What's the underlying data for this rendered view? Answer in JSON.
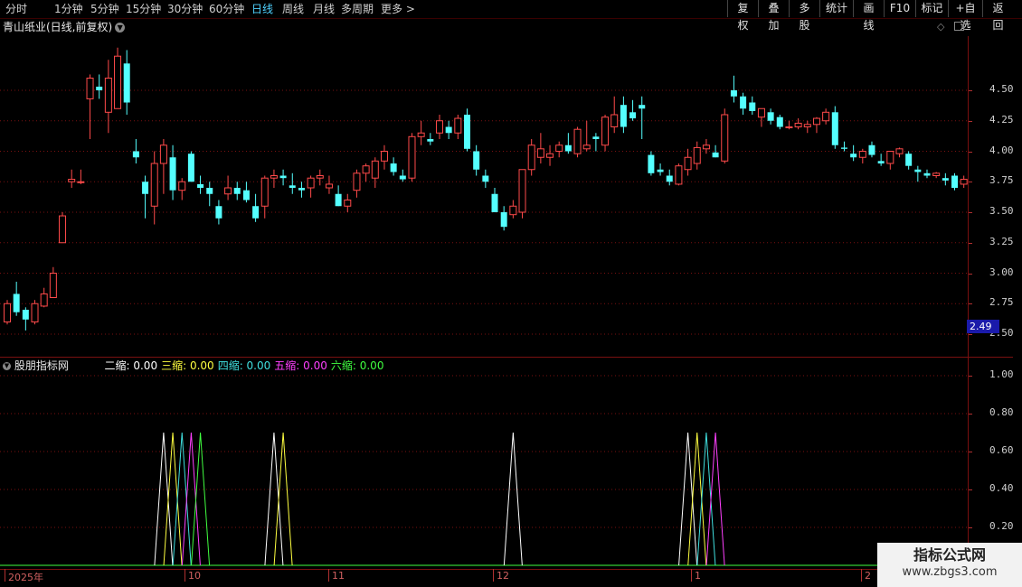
{
  "toolbar": {
    "periods": [
      "分时",
      "1分钟",
      "5分钟",
      "15分钟",
      "30分钟",
      "60分钟",
      "日线",
      "周线",
      "月线",
      "多周期",
      "更多 >"
    ],
    "active_period": "日线",
    "right_buttons": [
      "复权",
      "叠加",
      "多股",
      "统计",
      "画线",
      "F10",
      "标记",
      "+自选",
      "返回"
    ]
  },
  "stock": {
    "title": "青山纸业(日线,前复权)"
  },
  "price_axis": {
    "ticks": [
      "4.50",
      "4.25",
      "4.00",
      "3.75",
      "3.50",
      "3.25",
      "3.00",
      "2.75",
      "2.50"
    ],
    "current_price": "2.49"
  },
  "indicator": {
    "name": "股朋指标网",
    "legend": [
      {
        "label": "二缩:",
        "value": "0.00",
        "color": "#ffffff"
      },
      {
        "label": "三缩:",
        "value": "0.00",
        "color": "#ffff40"
      },
      {
        "label": "四缩:",
        "value": "0.00",
        "color": "#40e0e0"
      },
      {
        "label": "五缩:",
        "value": "0.00",
        "color": "#ff40ff"
      },
      {
        "label": "六缩:",
        "value": "0.00",
        "color": "#40ff40"
      }
    ],
    "axis_ticks": [
      "1.00",
      "0.80",
      "0.60",
      "0.40",
      "0.20"
    ]
  },
  "date_axis": {
    "labels": [
      "2025年",
      "10",
      "11",
      "12",
      "1",
      "2"
    ]
  },
  "watermark": {
    "title": "指标公式网",
    "url": "www.zbgs3.com"
  },
  "colors": {
    "up": "#ff4a4a",
    "down": "#54ffff",
    "grid": "#7a1010"
  },
  "chart_data": [
    {
      "type": "candlestick",
      "title": "青山纸业(日线,前复权)",
      "ylim": [
        2.45,
        4.85
      ],
      "y_ticks": [
        2.5,
        2.75,
        3.0,
        3.25,
        3.5,
        3.75,
        4.0,
        4.25,
        4.5
      ],
      "x_labels": [
        "2025年",
        "10",
        "11",
        "12",
        "1",
        "2"
      ],
      "ohlc": [
        [
          2.6,
          2.78,
          2.58,
          2.75
        ],
        [
          2.83,
          2.93,
          2.65,
          2.68
        ],
        [
          2.7,
          2.72,
          2.53,
          2.62
        ],
        [
          2.6,
          2.78,
          2.58,
          2.75
        ],
        [
          2.73,
          2.88,
          2.72,
          2.83
        ],
        [
          2.8,
          3.05,
          2.8,
          3.0
        ],
        [
          3.25,
          3.5,
          3.25,
          3.47
        ],
        [
          3.75,
          3.85,
          3.7,
          3.77
        ],
        [
          3.75,
          3.85,
          3.73,
          3.75
        ],
        [
          4.43,
          4.63,
          4.1,
          4.6
        ],
        [
          4.53,
          4.63,
          4.43,
          4.5
        ],
        [
          4.32,
          4.75,
          4.15,
          4.6
        ],
        [
          4.35,
          4.85,
          4.35,
          4.78
        ],
        [
          4.72,
          4.83,
          4.3,
          4.4
        ],
        [
          4.0,
          4.1,
          3.9,
          3.95
        ],
        [
          3.75,
          3.8,
          3.45,
          3.65
        ],
        [
          3.55,
          4.0,
          3.4,
          3.9
        ],
        [
          3.9,
          4.1,
          3.65,
          4.05
        ],
        [
          3.95,
          4.05,
          3.6,
          3.68
        ],
        [
          3.68,
          3.78,
          3.6,
          3.75
        ],
        [
          3.98,
          4.0,
          3.75,
          3.75
        ],
        [
          3.73,
          3.8,
          3.65,
          3.7
        ],
        [
          3.7,
          3.75,
          3.55,
          3.65
        ],
        [
          3.55,
          3.6,
          3.4,
          3.45
        ],
        [
          3.65,
          3.8,
          3.6,
          3.7
        ],
        [
          3.7,
          3.75,
          3.6,
          3.65
        ],
        [
          3.68,
          3.75,
          3.58,
          3.6
        ],
        [
          3.55,
          3.65,
          3.42,
          3.45
        ],
        [
          3.55,
          3.8,
          3.45,
          3.78
        ],
        [
          3.78,
          3.85,
          3.7,
          3.8
        ],
        [
          3.8,
          3.85,
          3.72,
          3.78
        ],
        [
          3.72,
          3.82,
          3.65,
          3.7
        ],
        [
          3.7,
          3.75,
          3.62,
          3.68
        ],
        [
          3.7,
          3.8,
          3.62,
          3.78
        ],
        [
          3.78,
          3.85,
          3.72,
          3.8
        ],
        [
          3.7,
          3.8,
          3.65,
          3.73
        ],
        [
          3.65,
          3.72,
          3.55,
          3.55
        ],
        [
          3.55,
          3.65,
          3.5,
          3.6
        ],
        [
          3.68,
          3.85,
          3.62,
          3.82
        ],
        [
          3.82,
          3.9,
          3.75,
          3.88
        ],
        [
          3.78,
          3.95,
          3.7,
          3.92
        ],
        [
          3.92,
          4.05,
          3.85,
          4.0
        ],
        [
          3.9,
          3.95,
          3.8,
          3.83
        ],
        [
          3.8,
          3.85,
          3.75,
          3.77
        ],
        [
          3.78,
          4.15,
          3.75,
          4.12
        ],
        [
          4.12,
          4.25,
          4.05,
          4.15
        ],
        [
          4.1,
          4.15,
          4.05,
          4.08
        ],
        [
          4.15,
          4.3,
          4.1,
          4.25
        ],
        [
          4.2,
          4.25,
          4.1,
          4.15
        ],
        [
          4.15,
          4.3,
          4.1,
          4.27
        ],
        [
          4.3,
          4.35,
          4.0,
          4.02
        ],
        [
          4.0,
          4.05,
          3.8,
          3.85
        ],
        [
          3.8,
          3.85,
          3.7,
          3.75
        ],
        [
          3.65,
          3.7,
          3.5,
          3.5
        ],
        [
          3.5,
          3.55,
          3.35,
          3.38
        ],
        [
          3.48,
          3.6,
          3.45,
          3.55
        ],
        [
          3.5,
          3.65,
          3.45,
          3.85
        ],
        [
          3.85,
          4.1,
          3.8,
          4.05
        ],
        [
          3.95,
          4.15,
          3.9,
          4.02
        ],
        [
          3.95,
          4.05,
          3.88,
          3.98
        ],
        [
          4.0,
          4.08,
          3.95,
          4.05
        ],
        [
          4.05,
          4.15,
          3.98,
          4.0
        ],
        [
          3.98,
          4.2,
          3.95,
          4.18
        ],
        [
          4.02,
          4.25,
          4.0,
          4.05
        ],
        [
          4.12,
          4.15,
          4.0,
          4.1
        ],
        [
          4.05,
          4.3,
          4.0,
          4.28
        ],
        [
          4.2,
          4.45,
          4.15,
          4.3
        ],
        [
          4.38,
          4.45,
          4.15,
          4.2
        ],
        [
          4.32,
          4.42,
          4.25,
          4.27
        ],
        [
          4.38,
          4.45,
          4.1,
          4.35
        ],
        [
          3.97,
          4.0,
          3.8,
          3.82
        ],
        [
          3.85,
          3.9,
          3.8,
          3.83
        ],
        [
          3.8,
          3.85,
          3.72,
          3.75
        ],
        [
          3.73,
          3.9,
          3.72,
          3.88
        ],
        [
          3.85,
          4.02,
          3.8,
          3.95
        ],
        [
          3.9,
          4.08,
          3.85,
          4.03
        ],
        [
          4.02,
          4.1,
          3.98,
          4.05
        ],
        [
          3.99,
          4.05,
          3.95,
          3.95
        ],
        [
          3.92,
          4.35,
          3.9,
          4.3
        ],
        [
          4.5,
          4.62,
          4.4,
          4.45
        ],
        [
          4.45,
          4.48,
          4.3,
          4.35
        ],
        [
          4.4,
          4.45,
          4.3,
          4.33
        ],
        [
          4.28,
          4.35,
          4.2,
          4.35
        ],
        [
          4.32,
          4.35,
          4.22,
          4.25
        ],
        [
          4.28,
          4.3,
          4.18,
          4.2
        ],
        [
          4.2,
          4.25,
          4.18,
          4.2
        ],
        [
          4.2,
          4.27,
          4.18,
          4.23
        ],
        [
          4.2,
          4.25,
          4.15,
          4.22
        ],
        [
          4.22,
          4.28,
          4.15,
          4.27
        ],
        [
          4.25,
          4.35,
          4.22,
          4.32
        ],
        [
          4.32,
          4.37,
          4.02,
          4.05
        ],
        [
          4.03,
          4.08,
          4.0,
          4.02
        ],
        [
          3.98,
          4.05,
          3.92,
          3.95
        ],
        [
          3.95,
          4.02,
          3.9,
          4.0
        ],
        [
          4.05,
          4.08,
          3.95,
          3.97
        ],
        [
          3.92,
          3.98,
          3.88,
          3.9
        ],
        [
          3.9,
          4.0,
          3.85,
          4.0
        ],
        [
          3.98,
          4.03,
          3.95,
          4.02
        ],
        [
          3.98,
          4.0,
          3.85,
          3.88
        ],
        [
          3.85,
          3.88,
          3.75,
          3.83
        ],
        [
          3.82,
          3.85,
          3.78,
          3.8
        ],
        [
          3.8,
          3.83,
          3.78,
          3.82
        ],
        [
          3.78,
          3.82,
          3.72,
          3.76
        ],
        [
          3.8,
          3.82,
          3.68,
          3.7
        ],
        [
          3.73,
          3.8,
          3.7,
          3.77
        ],
        [
          3.75,
          3.8,
          3.73,
          3.78
        ],
        [
          3.78,
          3.8,
          3.72,
          3.75
        ],
        [
          3.74,
          3.8,
          3.7,
          3.75
        ],
        [
          3.76,
          3.82,
          3.73,
          3.8
        ],
        [
          3.8,
          3.83,
          3.78,
          3.82
        ],
        [
          3.8,
          3.85,
          3.78,
          3.8
        ],
        [
          3.78,
          3.88,
          3.75,
          3.78
        ],
        [
          3.75,
          3.83,
          3.72,
          3.74
        ]
      ]
    },
    {
      "type": "line",
      "title": "股朋指标网",
      "ylim": [
        0,
        1.05
      ],
      "y_ticks": [
        0.2,
        0.4,
        0.6,
        0.8,
        1.0
      ],
      "series": [
        {
          "name": "二缩",
          "color": "#ffffff",
          "peaks": [
            17,
            29,
            55,
            74
          ]
        },
        {
          "name": "三缩",
          "color": "#ffff40",
          "peaks": [
            18,
            30,
            75
          ]
        },
        {
          "name": "四缩",
          "color": "#40e0e0",
          "peaks": [
            19,
            76
          ]
        },
        {
          "name": "五缩",
          "color": "#ff40ff",
          "peaks": [
            20,
            77
          ]
        },
        {
          "name": "六缩",
          "color": "#40ff40",
          "peaks": [
            21
          ]
        }
      ],
      "peak_value": 0.7
    }
  ]
}
